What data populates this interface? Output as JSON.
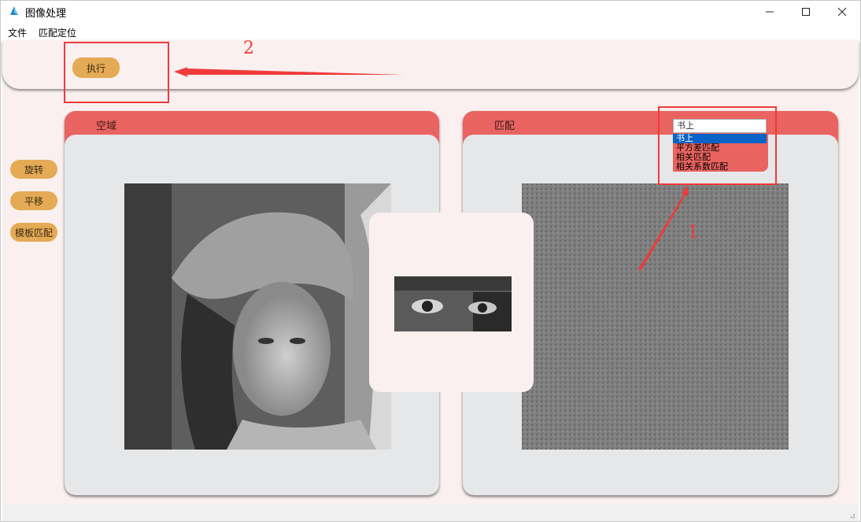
{
  "window": {
    "title": "图像处理"
  },
  "menu": {
    "items": [
      "文件",
      "匹配定位"
    ]
  },
  "toolbar": {
    "exec_label": "执行"
  },
  "side_buttons": {
    "rotate": "旋转",
    "pan": "平移",
    "template_match": "模板匹配"
  },
  "panels": {
    "left_title": "空域",
    "right_title": "匹配"
  },
  "dropdown": {
    "selected": "书上",
    "options": [
      "书上",
      "平方差匹配",
      "相关匹配",
      "相关系数匹配"
    ]
  },
  "annotations": {
    "label_1": "1",
    "label_2": "2"
  },
  "colors": {
    "accent": "#e96360",
    "button": "#e4aa55",
    "annotation": "#f03a3a",
    "selection": "#0a64c8"
  }
}
